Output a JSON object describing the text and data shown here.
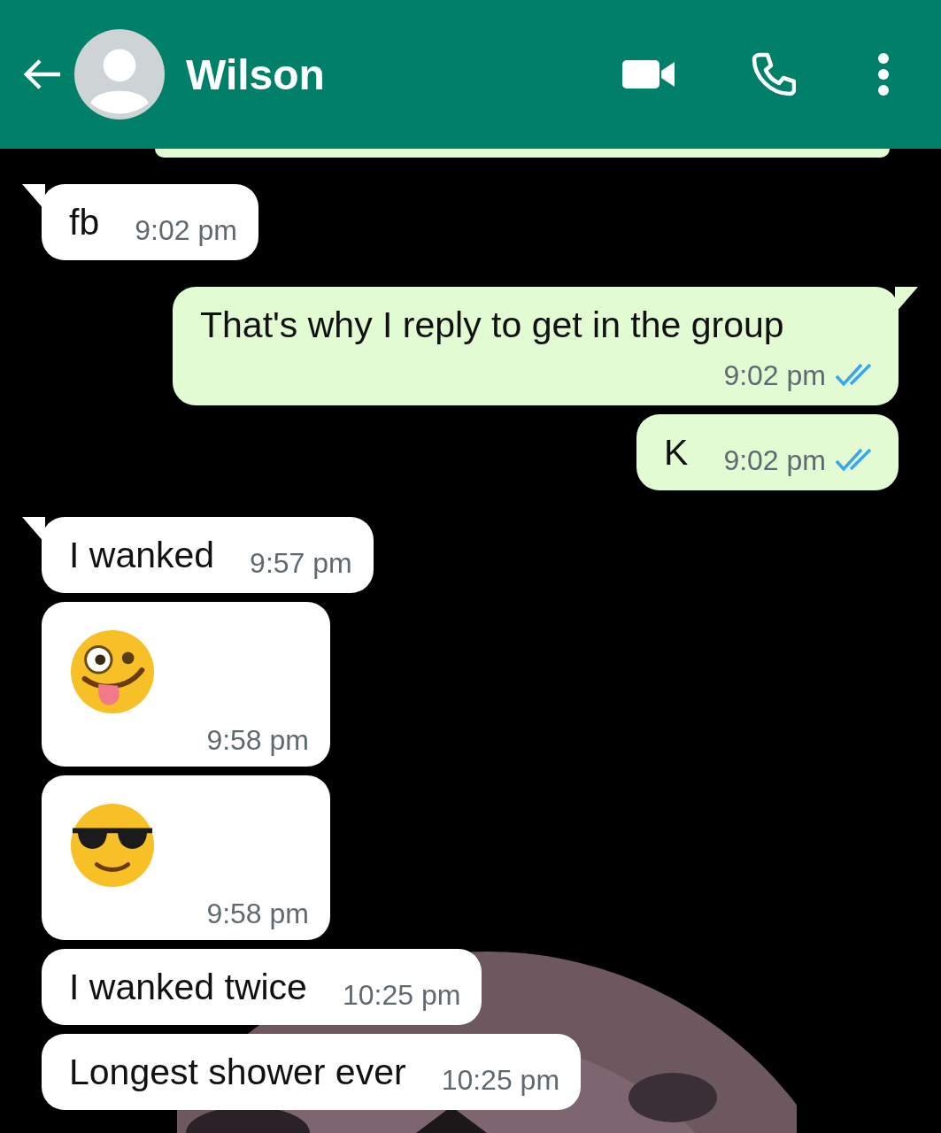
{
  "header": {
    "name": "Wilson"
  },
  "messages": [
    {
      "kind": "cut",
      "outgoing": true
    },
    {
      "kind": "text",
      "outgoing": false,
      "first": true,
      "text": "fb",
      "time": "9:02 pm"
    },
    {
      "kind": "text",
      "outgoing": true,
      "first": true,
      "text": "That's why I reply to get in the group",
      "time": "9:02 pm",
      "read": true
    },
    {
      "kind": "text",
      "outgoing": true,
      "first": false,
      "text": "K",
      "time": "9:02 pm",
      "read": true
    },
    {
      "kind": "text",
      "outgoing": false,
      "first": true,
      "text": "I wanked",
      "time": "9:57 pm"
    },
    {
      "kind": "zany",
      "outgoing": false,
      "first": false,
      "time": "9:58 pm"
    },
    {
      "kind": "shades",
      "outgoing": false,
      "first": false,
      "time": "9:58 pm"
    },
    {
      "kind": "text",
      "outgoing": false,
      "first": false,
      "text": "I wanked twice",
      "time": "10:25 pm"
    },
    {
      "kind": "text",
      "outgoing": false,
      "first": false,
      "text": "Longest shower ever",
      "time": "10:25 pm"
    }
  ]
}
